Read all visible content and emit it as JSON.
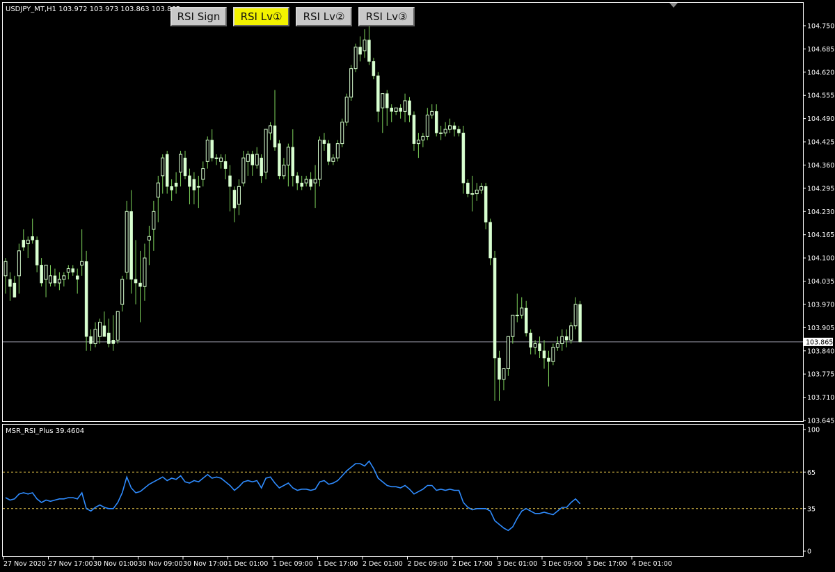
{
  "symbol_header": "USDJPY_MT,H1  103.972 103.973 103.863 103.865",
  "buttons": [
    {
      "label": "RSI Sign",
      "active": false
    },
    {
      "label": "RSI Lv①",
      "active": true
    },
    {
      "label": "RSI Lv②",
      "active": false
    },
    {
      "label": "RSI Lv③",
      "active": false
    }
  ],
  "colors": {
    "background": "#000000",
    "candle_up": "#d8ffd0",
    "candle_down": "#d8ffd0",
    "wick": "#7ed35c",
    "rsi_line": "#2f8cff",
    "level_line": "#e8c84a",
    "grid_border": "#ffffff",
    "current_price_line": "#9a9aa8",
    "button_active": "#f2f200",
    "button_inactive": "#c8c8c8"
  },
  "price_axis": {
    "ticks": [
      "104.750",
      "104.685",
      "104.620",
      "104.555",
      "104.490",
      "104.425",
      "104.360",
      "104.295",
      "104.230",
      "104.165",
      "104.100",
      "104.035",
      "103.970",
      "103.905",
      "103.840",
      "103.775",
      "103.710",
      "103.645"
    ],
    "current_price": "103.865"
  },
  "rsi_panel": {
    "title": "MSR_RSI_Plus 39.4604",
    "ticks": [
      "100",
      "65",
      "35",
      "0"
    ],
    "levels": [
      65,
      35
    ]
  },
  "time_axis": [
    "27 Nov 2020",
    "27 Nov 17:00",
    "30 Nov 01:00",
    "30 Nov 09:00",
    "30 Nov 17:00",
    "1 Dec 01:00",
    "1 Dec 09:00",
    "1 Dec 17:00",
    "2 Dec 01:00",
    "2 Dec 09:00",
    "2 Dec 17:00",
    "3 Dec 01:00",
    "3 Dec 09:00",
    "3 Dec 17:00",
    "4 Dec 01:00"
  ],
  "chart_data": {
    "type": "candlestick",
    "symbol": "USDJPY_MT",
    "timeframe": "H1",
    "price_range": [
      103.645,
      104.77
    ],
    "rsi_range": [
      0,
      100
    ],
    "candles": [
      [
        104.05,
        104.1,
        104.09,
        104.0
      ],
      [
        104.04,
        104.06,
        104.02,
        103.98
      ],
      [
        104.03,
        104.05,
        103.99,
        103.99
      ],
      [
        104.05,
        104.14,
        104.12,
        104.0
      ],
      [
        104.15,
        104.18,
        104.13,
        104.12
      ],
      [
        104.14,
        104.16,
        104.15,
        104.1
      ],
      [
        104.16,
        104.21,
        104.15,
        104.14
      ],
      [
        104.15,
        104.16,
        104.08,
        104.06
      ],
      [
        104.08,
        104.1,
        104.03,
        104.02
      ],
      [
        104.04,
        104.07,
        104.08,
        103.99
      ],
      [
        104.03,
        104.08,
        104.05,
        104.02
      ],
      [
        104.05,
        104.07,
        104.03,
        104.02
      ],
      [
        104.03,
        104.06,
        104.04,
        104.01
      ],
      [
        104.04,
        104.06,
        104.05,
        104.02
      ],
      [
        104.06,
        104.08,
        104.07,
        104.04
      ],
      [
        104.07,
        104.08,
        104.06,
        104.05
      ],
      [
        104.05,
        104.07,
        104.04,
        104.0
      ],
      [
        104.08,
        104.18,
        104.09,
        104.05
      ],
      [
        104.09,
        104.12,
        103.88,
        103.84
      ],
      [
        103.88,
        103.9,
        103.86,
        103.84
      ],
      [
        103.86,
        103.92,
        103.9,
        103.85
      ],
      [
        103.88,
        103.93,
        103.92,
        103.86
      ],
      [
        103.91,
        103.95,
        103.88,
        103.88
      ],
      [
        103.89,
        103.93,
        103.86,
        103.85
      ],
      [
        103.87,
        103.94,
        103.86,
        103.84
      ],
      [
        103.87,
        103.95,
        103.95,
        103.86
      ],
      [
        103.97,
        104.05,
        104.04,
        103.95
      ],
      [
        104.06,
        104.26,
        104.23,
        104.04
      ],
      [
        104.23,
        104.29,
        104.04,
        104.0
      ],
      [
        104.04,
        104.15,
        104.03,
        103.97
      ],
      [
        104.03,
        104.12,
        104.02,
        103.92
      ],
      [
        104.02,
        104.14,
        104.1,
        103.98
      ],
      [
        104.15,
        104.19,
        104.16,
        104.08
      ],
      [
        104.18,
        104.26,
        104.23,
        104.12
      ],
      [
        104.27,
        104.33,
        104.31,
        104.2
      ],
      [
        104.33,
        104.39,
        104.38,
        104.28
      ],
      [
        104.39,
        104.4,
        104.3,
        104.28
      ],
      [
        104.3,
        104.32,
        104.29,
        104.26
      ],
      [
        104.31,
        104.34,
        104.3,
        104.28
      ],
      [
        104.34,
        104.4,
        104.39,
        104.3
      ],
      [
        104.38,
        104.4,
        104.33,
        104.32
      ],
      [
        104.33,
        104.35,
        104.3,
        104.25
      ],
      [
        104.32,
        104.34,
        104.29,
        104.25
      ],
      [
        104.3,
        104.33,
        104.3,
        104.24
      ],
      [
        104.32,
        104.37,
        104.35,
        104.3
      ],
      [
        104.37,
        104.44,
        104.43,
        104.35
      ],
      [
        104.43,
        104.46,
        104.38,
        104.37
      ],
      [
        104.38,
        104.39,
        104.38,
        104.36
      ],
      [
        104.37,
        104.39,
        104.38,
        104.35
      ],
      [
        104.37,
        104.39,
        104.35,
        104.32
      ],
      [
        104.33,
        104.36,
        104.3,
        104.23
      ],
      [
        104.29,
        104.3,
        104.24,
        104.2
      ],
      [
        104.25,
        104.32,
        104.3,
        104.22
      ],
      [
        104.31,
        104.4,
        104.38,
        104.3
      ],
      [
        104.37,
        104.4,
        104.39,
        104.33
      ],
      [
        104.39,
        104.4,
        104.36,
        104.33
      ],
      [
        104.36,
        104.41,
        104.39,
        104.35
      ],
      [
        104.38,
        104.39,
        104.33,
        104.31
      ],
      [
        104.34,
        104.42,
        104.46,
        104.32
      ],
      [
        104.45,
        104.48,
        104.47,
        104.43
      ],
      [
        104.47,
        104.57,
        104.41,
        104.4
      ],
      [
        104.42,
        104.43,
        104.33,
        104.32
      ],
      [
        104.33,
        104.38,
        104.36,
        104.32
      ],
      [
        104.36,
        104.42,
        104.41,
        104.3
      ],
      [
        104.41,
        104.46,
        104.33,
        104.3
      ],
      [
        104.33,
        104.34,
        104.31,
        104.29
      ],
      [
        104.31,
        104.33,
        104.3,
        104.29
      ],
      [
        104.31,
        104.33,
        104.32,
        104.3
      ],
      [
        104.32,
        104.34,
        104.3,
        104.29
      ],
      [
        104.31,
        104.36,
        104.32,
        104.24
      ],
      [
        104.32,
        104.44,
        104.43,
        104.3
      ],
      [
        104.43,
        104.45,
        104.42,
        104.4
      ],
      [
        104.42,
        104.43,
        104.37,
        104.36
      ],
      [
        104.37,
        104.39,
        104.38,
        104.36
      ],
      [
        104.38,
        104.43,
        104.42,
        104.37
      ],
      [
        104.42,
        104.49,
        104.48,
        104.41
      ],
      [
        104.48,
        104.56,
        104.55,
        104.47
      ],
      [
        104.55,
        104.64,
        104.63,
        104.54
      ],
      [
        104.63,
        104.7,
        104.69,
        104.62
      ],
      [
        104.69,
        104.72,
        104.67,
        104.65
      ],
      [
        104.68,
        104.74,
        104.71,
        104.66
      ],
      [
        104.71,
        104.76,
        104.65,
        104.64
      ],
      [
        104.65,
        104.66,
        104.61,
        104.6
      ],
      [
        104.61,
        104.62,
        104.51,
        104.48
      ],
      [
        104.52,
        104.54,
        104.56,
        104.45
      ],
      [
        104.56,
        104.57,
        104.52,
        104.47
      ],
      [
        104.52,
        104.53,
        104.51,
        104.48
      ],
      [
        104.51,
        104.52,
        104.52,
        104.5
      ],
      [
        104.52,
        104.53,
        104.51,
        104.49
      ],
      [
        104.51,
        104.56,
        104.54,
        104.48
      ],
      [
        104.54,
        104.55,
        104.5,
        104.48
      ],
      [
        104.5,
        104.51,
        104.42,
        104.4
      ],
      [
        104.42,
        104.45,
        104.43,
        104.38
      ],
      [
        104.43,
        104.45,
        104.44,
        104.41
      ],
      [
        104.44,
        104.52,
        104.5,
        104.43
      ],
      [
        104.5,
        104.53,
        104.51,
        104.49
      ],
      [
        104.51,
        104.53,
        104.45,
        104.44
      ],
      [
        104.45,
        104.47,
        104.45,
        104.43
      ],
      [
        104.45,
        104.48,
        104.46,
        104.44
      ],
      [
        104.46,
        104.49,
        104.47,
        104.45
      ],
      [
        104.47,
        104.48,
        104.46,
        104.44
      ],
      [
        104.46,
        104.47,
        104.45,
        104.44
      ],
      [
        104.45,
        104.47,
        104.31,
        104.28
      ],
      [
        104.31,
        104.32,
        104.28,
        104.27
      ],
      [
        104.28,
        104.33,
        104.28,
        104.23
      ],
      [
        104.28,
        104.31,
        104.29,
        104.26
      ],
      [
        104.29,
        104.31,
        104.3,
        104.28
      ],
      [
        104.3,
        104.31,
        104.2,
        104.18
      ],
      [
        104.2,
        104.21,
        104.1,
        104.08
      ],
      [
        104.1,
        104.12,
        103.82,
        103.7
      ],
      [
        103.82,
        103.84,
        103.76,
        103.7
      ],
      [
        103.76,
        103.79,
        103.79,
        103.73
      ],
      [
        103.79,
        103.88,
        103.88,
        103.77
      ],
      [
        103.88,
        103.92,
        103.94,
        103.86
      ],
      [
        103.94,
        104.0,
        103.94,
        103.92
      ],
      [
        103.94,
        103.99,
        103.96,
        103.93
      ],
      [
        103.96,
        103.98,
        103.89,
        103.88
      ],
      [
        103.89,
        103.9,
        103.85,
        103.83
      ],
      [
        103.85,
        103.87,
        103.86,
        103.83
      ],
      [
        103.86,
        103.88,
        103.84,
        103.82
      ],
      [
        103.84,
        103.87,
        103.82,
        103.79
      ],
      [
        103.82,
        103.84,
        103.81,
        103.74
      ],
      [
        103.81,
        103.86,
        103.85,
        103.8
      ],
      [
        103.85,
        103.88,
        103.86,
        103.84
      ],
      [
        103.86,
        103.9,
        103.88,
        103.84
      ],
      [
        103.88,
        103.9,
        103.87,
        103.85
      ],
      [
        103.87,
        103.92,
        103.91,
        103.86
      ],
      [
        103.91,
        103.99,
        103.97,
        103.9
      ],
      [
        103.97,
        103.98,
        103.865,
        103.863
      ]
    ],
    "rsi": [
      44,
      42,
      43,
      47,
      48,
      47,
      48,
      43,
      40,
      42,
      41,
      42,
      43,
      43,
      44,
      44,
      43,
      48,
      35,
      33,
      36,
      38,
      36,
      35,
      35,
      40,
      48,
      61,
      52,
      48,
      49,
      52,
      55,
      57,
      59,
      61,
      58,
      60,
      59,
      62,
      57,
      56,
      58,
      57,
      60,
      63,
      60,
      61,
      60,
      57,
      54,
      50,
      53,
      57,
      58,
      57,
      58,
      52,
      60,
      61,
      56,
      52,
      54,
      56,
      52,
      50,
      51,
      51,
      50,
      51,
      57,
      58,
      55,
      56,
      58,
      62,
      66,
      69,
      72,
      72,
      70,
      74,
      68,
      60,
      57,
      54,
      53,
      53,
      52,
      54,
      51,
      47,
      49,
      51,
      54,
      54,
      50,
      51,
      50,
      51,
      50,
      50,
      40,
      36,
      34,
      35,
      35,
      35,
      33,
      25,
      22,
      19,
      17,
      20,
      27,
      33,
      35,
      33,
      31,
      31,
      32,
      31,
      30,
      33,
      36,
      36,
      40,
      43,
      39
    ]
  }
}
